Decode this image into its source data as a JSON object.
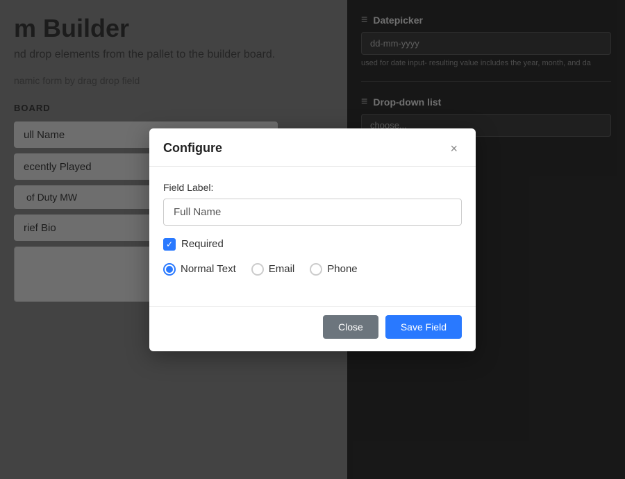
{
  "page": {
    "title": "m Builder",
    "subtitle": "nd drop elements from the pallet to the builder board.",
    "desc": "namic form by drag drop field",
    "board_label": "BOARD",
    "fields": [
      {
        "name": "ull Name",
        "has_wrench": true,
        "has_x": true
      },
      {
        "name": "ecently Played",
        "has_wrench": true,
        "has_x": true
      }
    ],
    "select_field": {
      "value": "of Duty MW"
    },
    "textarea_field": {
      "label": "rief Bio"
    }
  },
  "right_panel": {
    "sections": [
      {
        "id": "datepicker",
        "title": "Datepicker",
        "input_placeholder": "dd-mm-yyyy",
        "hint": "used for date input- resulting value includes the year, month, and da"
      },
      {
        "id": "dropdown",
        "title": "Drop-down list",
        "input_placeholder": "choose..."
      }
    ]
  },
  "modal": {
    "title": "Configure",
    "close_label": "×",
    "field_label_text": "Field Label:",
    "field_label_value": "Full Name",
    "field_label_placeholder": "Full Name",
    "required_label": "Required",
    "required_checked": true,
    "radio_options": [
      {
        "id": "normal",
        "label": "Normal Text",
        "selected": true
      },
      {
        "id": "email",
        "label": "Email",
        "selected": false
      },
      {
        "id": "phone",
        "label": "Phone",
        "selected": false
      }
    ],
    "btn_close": "Close",
    "btn_save": "Save Field"
  }
}
